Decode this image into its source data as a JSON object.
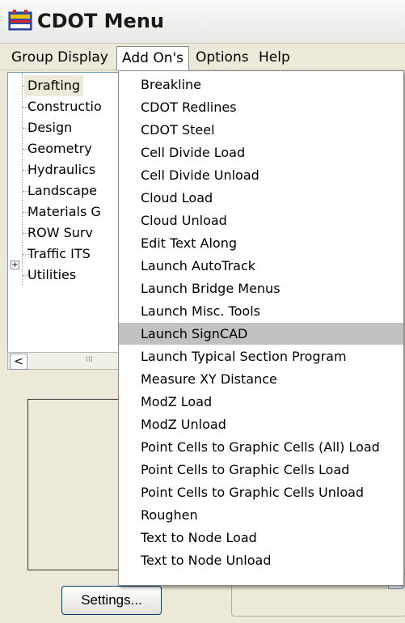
{
  "window": {
    "title": "CDOT Menu",
    "icon": "cdot-app-icon"
  },
  "menubar": {
    "items": [
      "Group Display",
      "Add On's",
      "Options",
      "Help"
    ],
    "active": "Add On's"
  },
  "tree": {
    "items": [
      {
        "label": "Drafting",
        "selected": true
      },
      {
        "label": "Constructio"
      },
      {
        "label": "Design"
      },
      {
        "label": "Geometry"
      },
      {
        "label": "Hydraulics"
      },
      {
        "label": "Landscape"
      },
      {
        "label": "Materials G"
      },
      {
        "label": "ROW Surv"
      },
      {
        "label": "Traffic ITS",
        "expandable": true,
        "expander": "+"
      },
      {
        "label": "Utilities"
      }
    ]
  },
  "hscroll": {
    "left_arrow": "<",
    "thumb_grip": "III"
  },
  "buttons": {
    "settings": "Settings..."
  },
  "dropdown": {
    "highlighted": "Launch SignCAD",
    "items": [
      "Breakline",
      "CDOT Redlines",
      "CDOT Steel",
      "Cell Divide Load",
      "Cell Divide Unload",
      "Cloud Load",
      "Cloud Unload",
      "Edit Text Along",
      "Launch AutoTrack",
      "Launch Bridge Menus",
      "Launch Misc. Tools",
      "Launch SignCAD",
      "Launch Typical Section Program",
      "Measure XY Distance",
      "ModZ Load",
      "ModZ Unload",
      "Point Cells to Graphic Cells (All) Load",
      "Point Cells to Graphic Cells Load",
      "Point Cells to Graphic Cells Unload",
      "Roughen",
      "Text to Node Load",
      "Text to Node Unload"
    ]
  }
}
